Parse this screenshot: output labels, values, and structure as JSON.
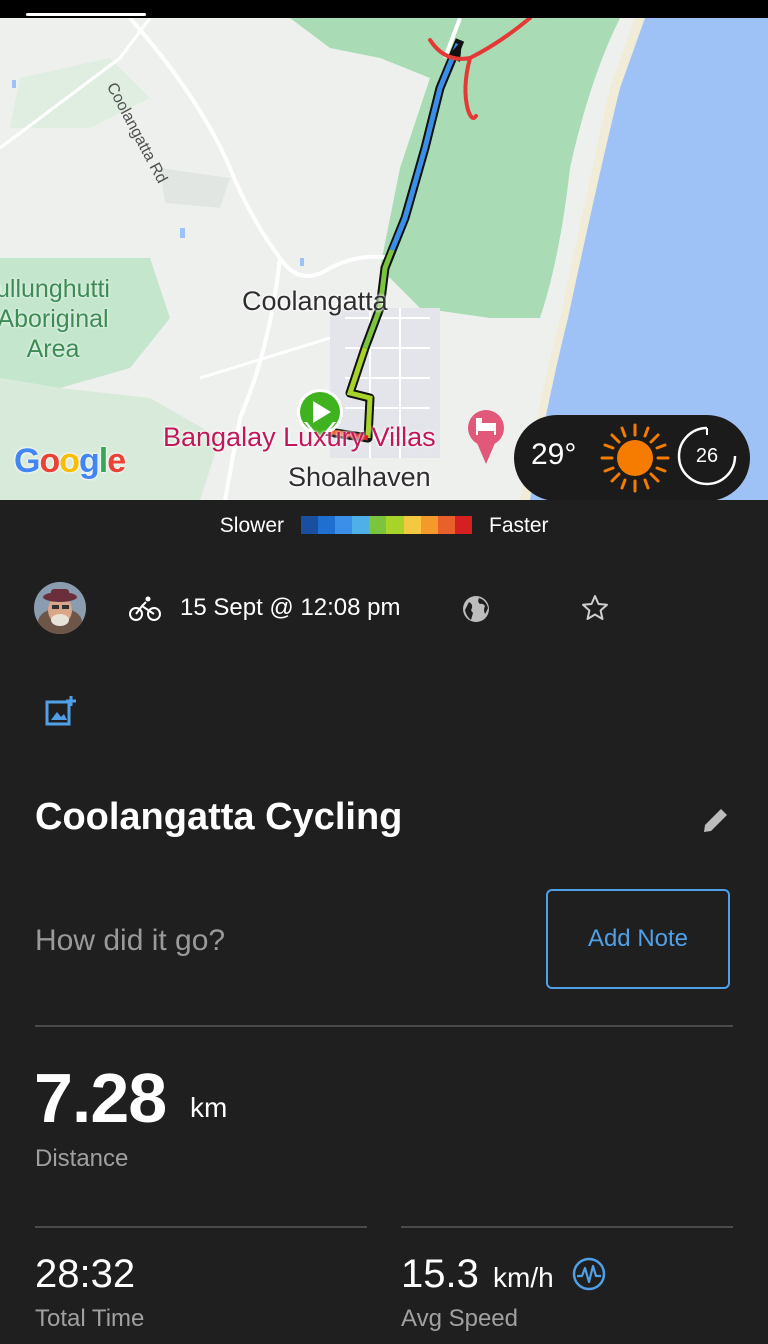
{
  "map": {
    "labels": {
      "road": "Coolangatta Rd",
      "town": "Coolangatta",
      "aboriginal_area": [
        "ullunghutti",
        "Aboriginal",
        "Area"
      ],
      "villas": "Bangalay Luxury Villas",
      "shoalhaven": "Shoalhaven"
    },
    "attribution": [
      "G",
      "o",
      "o",
      "g",
      "l",
      "e"
    ],
    "attribution_colors": [
      "#4285F4",
      "#EA4335",
      "#FBBC05",
      "#4285F4",
      "#34A853",
      "#EA4335"
    ]
  },
  "weather": {
    "temperature": "29°",
    "condition_icon": "sun-icon",
    "dial_value": "26"
  },
  "speed_legend": {
    "slower_label": "Slower",
    "faster_label": "Faster",
    "colors": [
      "#1a4fa0",
      "#1f6fd0",
      "#3b8fe8",
      "#4fb0e8",
      "#7bc43e",
      "#a8d42a",
      "#f5c842",
      "#f59a2a",
      "#e8602a",
      "#d42020"
    ]
  },
  "activity": {
    "activity_icon": "bicycle-icon",
    "date": "15 Sept @ 12:08 pm",
    "privacy_icon": "globe-icon",
    "favorite_icon": "star-icon",
    "add_photo_icon": "add-photo-icon",
    "title": "Coolangatta Cycling",
    "edit_icon": "pencil-icon",
    "note_prompt": "How did it go?",
    "add_note_label": "Add Note"
  },
  "stats": {
    "distance": {
      "value": "7.28",
      "unit": "km",
      "label": "Distance"
    },
    "total_time": {
      "value": "28:32",
      "label": "Total Time"
    },
    "avg_speed": {
      "value": "15.3",
      "unit": "km/h",
      "label": "Avg Speed",
      "icon": "speed-graph-icon"
    }
  },
  "colors": {
    "accent": "#4fa0e6",
    "background": "#1f1f20",
    "start_marker": "#3fb21f"
  }
}
